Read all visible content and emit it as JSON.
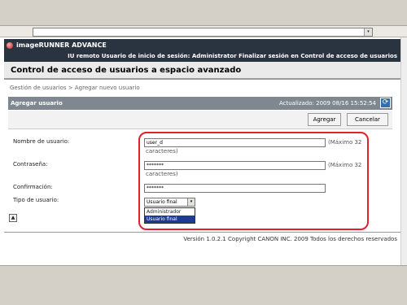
{
  "browser": {
    "address_dropdown": "▾"
  },
  "header": {
    "product": "imageRUNNER ADVANCE",
    "remote_ui": "IU remoto",
    "login_user": "Usuario de inicio de sesión: Administrator",
    "logout": "Finalizar sesión",
    "access_control": "en Control de acceso de usuarios"
  },
  "page": {
    "title": "Control de acceso de usuarios a espacio avanzado",
    "breadcrumb": "Gestión de usuarios > Agregar nuevo usuario"
  },
  "section": {
    "title": "Agregar usuario",
    "updated": "Actualizado: 2009 08/16 15:52:54",
    "refresh_icon": "refresh-icon"
  },
  "buttons": {
    "add": "Agregar",
    "cancel": "Cancelar"
  },
  "form": {
    "username_label": "Nombre de usuario:",
    "username_value": "user_d",
    "username_hint": "(Máximo 32",
    "username_hint2": "caracteres)",
    "password_label": "Contraseña:",
    "password_value": "*******",
    "password_hint": "(Máximo 32",
    "password_hint2": "caracteres)",
    "confirm_label": "Confirmación:",
    "confirm_value": "*******",
    "usertype_label": "Tipo de usuario:",
    "usertype_selected": "Usuario final",
    "usertype_options": [
      "Administrador",
      "Usuario final"
    ]
  },
  "footer": {
    "version": "Versión 1.0.2.1 Copyright CANON INC. 2009 Todos los derechos reservados"
  },
  "colors": {
    "header_bg": "#2a3340",
    "section_bg": "#7f8891",
    "highlight": "#e0202c",
    "selected_option": "#1f3a93"
  }
}
